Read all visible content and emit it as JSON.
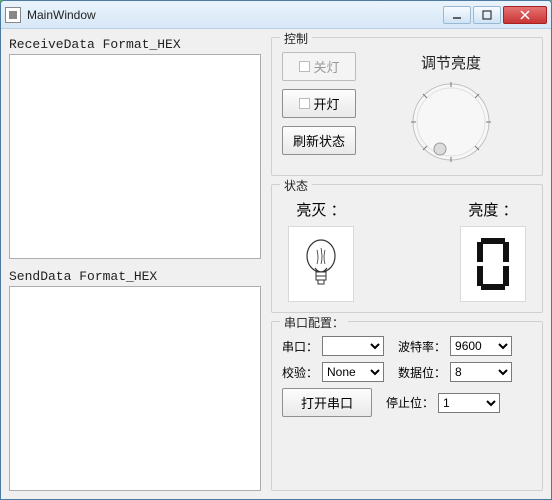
{
  "window": {
    "title": "MainWindow"
  },
  "left": {
    "receive_label": "ReceiveData Format_HEX",
    "send_label": "SendData Format_HEX",
    "receive_value": "",
    "send_value": ""
  },
  "control_group": {
    "title": "控制",
    "off_label": "关灯",
    "on_label": "开灯",
    "refresh_label": "刷新状态",
    "dial_title": "调节亮度"
  },
  "status_group": {
    "title": "状态",
    "onoff_label": "亮灭 ：",
    "brightness_label": "亮度 ：",
    "brightness_value": "0"
  },
  "serial_group": {
    "title": "串口配置：",
    "port_label": "串口：",
    "parity_label": "校验：",
    "baud_label": "波特率：",
    "databits_label": "数据位：",
    "stopbits_label": "停止位：",
    "open_label": "打开串口",
    "port_value": "",
    "parity_value": "None",
    "baud_value": "9600",
    "databits_value": "8",
    "stopbits_value": "1"
  }
}
